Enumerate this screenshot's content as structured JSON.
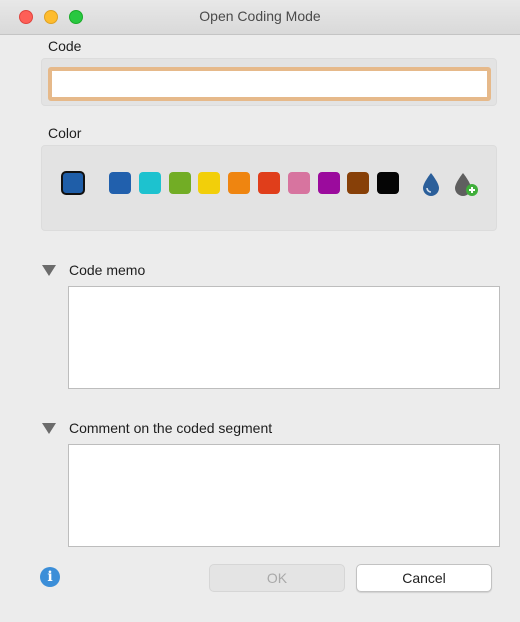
{
  "window": {
    "title": "Open Coding Mode"
  },
  "code": {
    "label": "Code",
    "value": "",
    "placeholder": ""
  },
  "color": {
    "label": "Color",
    "selected": "#1f5ea8",
    "swatches": [
      "#2160ad",
      "#1dc2cf",
      "#72ad25",
      "#f2cf0a",
      "#ef8510",
      "#e03e1b",
      "#d7749f",
      "#9b0b9d",
      "#874008",
      "#050505"
    ],
    "icons": [
      "color-dropper-icon",
      "add-custom-color-icon"
    ]
  },
  "code_memo": {
    "label": "Code memo",
    "value": ""
  },
  "comment": {
    "label": "Comment on the coded segment",
    "value": ""
  },
  "footer": {
    "ok_label": "OK",
    "cancel_label": "Cancel",
    "ok_enabled": false,
    "info_icon": "info-icon"
  }
}
